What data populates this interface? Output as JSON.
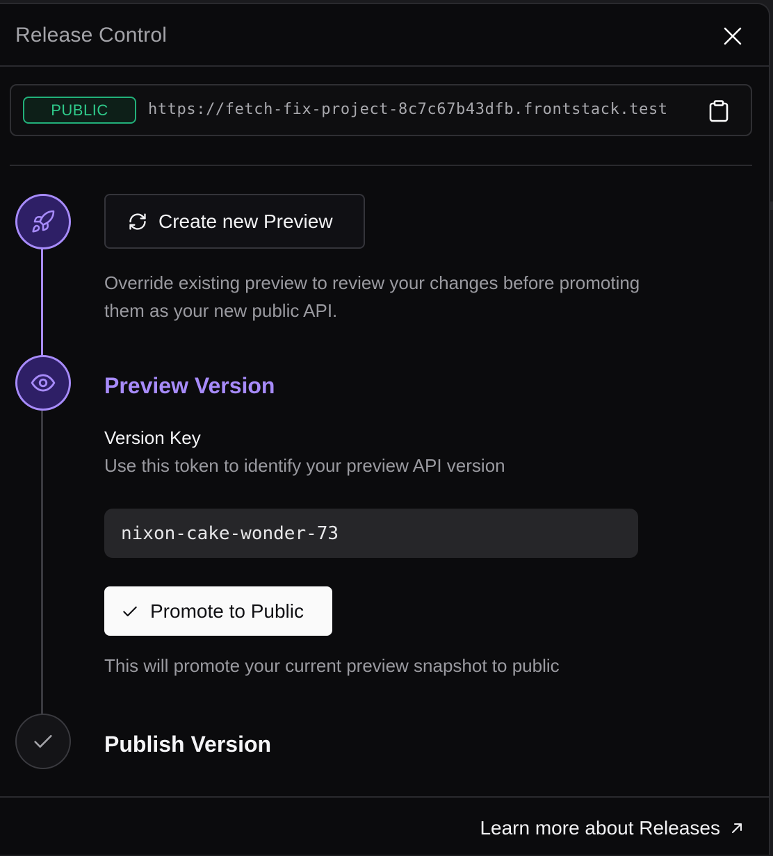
{
  "header": {
    "title": "Release Control",
    "close_icon": "close-icon"
  },
  "url_bar": {
    "badge": "PUBLIC",
    "url": "https://fetch-fix-project-8c7c67b43dfb.frontstack.test",
    "copy_icon": "clipboard-icon"
  },
  "steps": {
    "create": {
      "icon": "rocket-icon",
      "button_label": "Create new Preview",
      "button_icon": "refresh-icon",
      "description_line1": "Override existing preview to review your changes before promoting",
      "description_line2": "them as your new public API."
    },
    "preview": {
      "icon": "eye-icon",
      "heading": "Preview Version",
      "version_key_label": "Version Key",
      "version_key_help": "Use this token to identify your preview API version",
      "version_key_value": "nixon-cake-wonder-73",
      "promote_label": "Promote to Public",
      "promote_icon": "check-icon",
      "promote_help": "This will promote your current preview snapshot to public"
    },
    "publish": {
      "icon": "check-icon",
      "heading": "Publish Version"
    }
  },
  "footer": {
    "link_label": "Learn more about Releases",
    "link_icon": "arrow-up-right-icon"
  },
  "colors": {
    "accent": "#a78bfa",
    "public_green": "#2fcb8b",
    "background": "#0b0b0d"
  }
}
